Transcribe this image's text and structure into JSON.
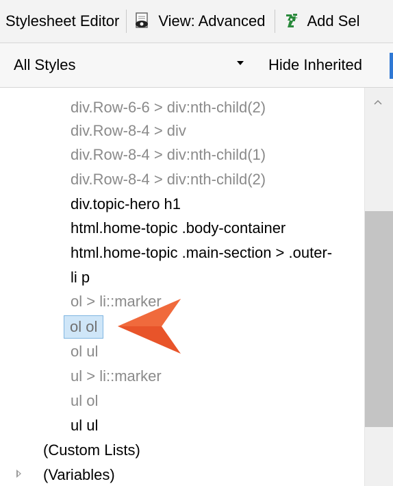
{
  "toolbar": {
    "title": "Stylesheet Editor",
    "view_label": "View: Advanced",
    "add_label": "Add Sel"
  },
  "filter": {
    "selected": "All Styles",
    "hide_inherited_label": "Hide Inherited"
  },
  "tree": {
    "items": [
      {
        "label": "div.Row-6-6 > div:nth-child(2)",
        "state": "inherited"
      },
      {
        "label": "div.Row-8-4 > div",
        "state": "inherited"
      },
      {
        "label": "div.Row-8-4 > div:nth-child(1)",
        "state": "inherited"
      },
      {
        "label": "div.Row-8-4 > div:nth-child(2)",
        "state": "inherited"
      },
      {
        "label": "div.topic-hero h1",
        "state": "normal"
      },
      {
        "label": "html.home-topic .body-container",
        "state": "normal"
      },
      {
        "label": "html.home-topic .main-section > .outer-",
        "state": "normal"
      },
      {
        "label": "li p",
        "state": "normal"
      },
      {
        "label": "ol > li::marker",
        "state": "inherited"
      },
      {
        "label": "ol ol",
        "state": "selected"
      },
      {
        "label": "ol ul",
        "state": "inherited"
      },
      {
        "label": "ul > li::marker",
        "state": "inherited"
      },
      {
        "label": "ul ol",
        "state": "inherited"
      },
      {
        "label": "ul ul",
        "state": "normal"
      }
    ],
    "groups": [
      {
        "label": "(Custom Lists)"
      },
      {
        "label": "(Variables)"
      }
    ]
  },
  "colors": {
    "callout_arrow": "#e8542a",
    "selection_bg": "#cfe6f8",
    "selection_border": "#7fb5e1"
  }
}
